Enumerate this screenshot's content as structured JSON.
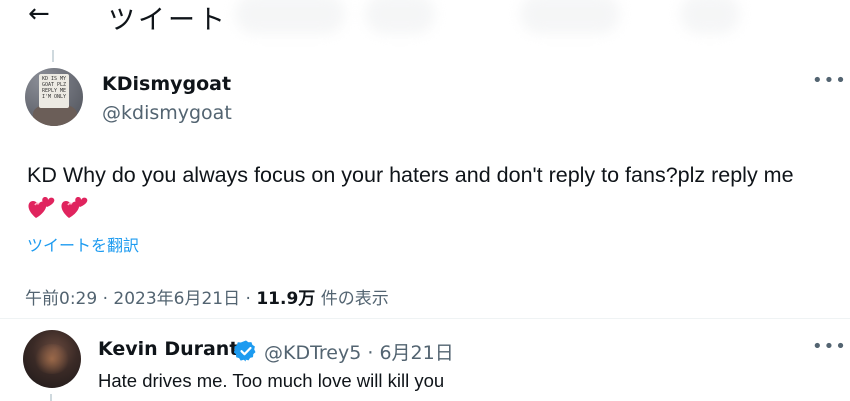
{
  "header": {
    "back_icon": "arrow-left-icon",
    "title": "ツイート"
  },
  "tweet": {
    "avatar_sign_text": "KD IS MY GOAT PLZ REPLY ME I'M ONLY",
    "display_name": "KDismygoat",
    "handle": "@kdismygoat",
    "more_icon": "more-horizontal-icon",
    "text": "KD Why do you always focus on your haters and don't reply to fans?plz reply me",
    "emoji": "💞💞",
    "translate_label": "ツイートを翻訳",
    "time": "午前0:29",
    "date": "2023年6月21日",
    "views_count": "11.9万",
    "views_label": "件の表示",
    "separator": "·"
  },
  "reply": {
    "display_name": "Kevin Durant",
    "verified_icon": "verified-badge-icon",
    "handle": "@KDTrey5",
    "date": "6月21日",
    "text": "Hate drives me. Too much love will kill you",
    "more_icon": "more-horizontal-icon"
  },
  "colors": {
    "accent": "#1d9bf0",
    "secondary_text": "#536471",
    "primary_text": "#0f1419"
  }
}
